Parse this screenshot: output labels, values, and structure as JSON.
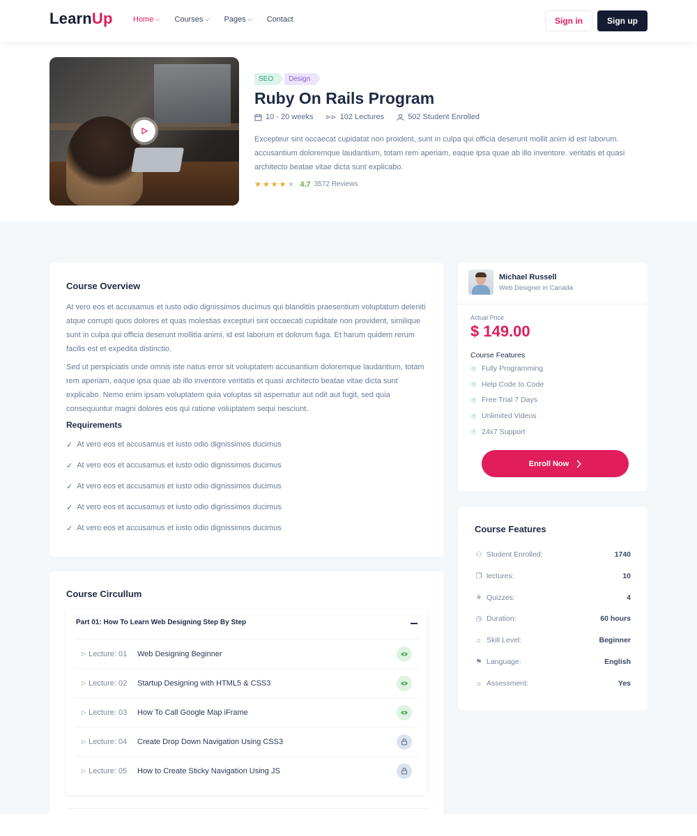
{
  "nav": {
    "logo_main": "Learn",
    "logo_accent": "Up",
    "menu": [
      {
        "label": "Home",
        "active": true,
        "dropdown": true
      },
      {
        "label": "Courses",
        "active": false,
        "dropdown": true
      },
      {
        "label": "Pages",
        "active": false,
        "dropdown": true
      },
      {
        "label": "Contact",
        "active": false,
        "dropdown": false
      }
    ],
    "signin": "Sign in",
    "signup": "Sign up"
  },
  "course": {
    "tags": [
      "SEO",
      "Design"
    ],
    "title": "Ruby On Rails Program",
    "duration": "10 - 20 weeks",
    "lectures": "102 Lectures",
    "enrolled": "502 Student Enrolled",
    "description": "Excepteur sint occaecat cupidatat non proident, sunt in culpa qui officia deserunt mollit anim id est laborum. accusantium doloremque laudantium, totam rem aperiam, eaque ipsa quae ab illo inventore. veritatis et quasi architecto beatae vitae dicta sunt explicabo.",
    "rating_value": "4.7",
    "rating_stars": 4,
    "reviews": "3572 Reviews"
  },
  "overview": {
    "title": "Course Overview",
    "p1": "At vero eos et accusamus et iusto odio dignissimos ducimus qui blanditiis praesentium voluptatum deleniti atque corrupti quos dolores et quas molestias excepturi sint occaecati cupiditate non provident, similique sunt in culpa qui officia deserunt mollitia animi, id est laborum et dolorum fuga. Et harum quidem rerum facilis est et expedita distinctio.",
    "p2": "Sed ut perspiciatis unde omnis iste natus error sit voluptatem accusantium doloremque laudantium, totam rem aperiam, eaque ipsa quae ab illo inventore veritatis et quasi architecto beatae vitae dicta sunt explicabo. Nemo enim ipsam voluptatem quia voluptas sit aspernatur aut odit aut fugit, sed quia consequuntur magni dolores eos qui ratione voluptatem sequi nesciunt.",
    "req_title": "Requirements",
    "requirements": [
      "At vero eos et accusamus et iusto odio dignissimos ducimus",
      "At vero eos et accusamus et iusto odio dignissimos ducimus",
      "At vero eos et accusamus et iusto odio dignissimos ducimus",
      "At vero eos et accusamus et iusto odio dignissimos ducimus",
      "At vero eos et accusamus et iusto odio dignissimos ducimus"
    ]
  },
  "curriculum": {
    "title": "Course Circullum",
    "part_title": "Part 01: How To Learn Web Designing Step By Step",
    "lectures": [
      {
        "num": "Lecture: 01",
        "title": "Web Designing Beginner",
        "icon": "eye-icon"
      },
      {
        "num": "Lecture: 02",
        "title": "Startup Designing with HTML5 & CSS3",
        "icon": "eye-icon"
      },
      {
        "num": "Lecture: 03",
        "title": "How To Call Google Map iFrame",
        "icon": "eye-icon"
      },
      {
        "num": "Lecture: 04",
        "title": "Create Drop Down Navigation Using CSS3",
        "icon": "lock-icon"
      },
      {
        "num": "Lecture: 05",
        "title": "How to Create Sticky Navigation Using JS",
        "icon": "lock-icon"
      }
    ]
  },
  "pricing": {
    "instructor_name": "Michael Russell",
    "instructor_role": "Web Designer in Canada",
    "price_label": "Actual Price",
    "price": "$ 149.00",
    "features_title": "Course Features",
    "features": [
      "Fully Programming",
      "Help Code to Code",
      "Free Trial 7 Days",
      "Unlimited Videos",
      "24x7 Support"
    ],
    "enroll": "Enroll Now"
  },
  "course_features": {
    "title": "Course Features",
    "rows": [
      {
        "icon": "user-icon",
        "label": "Student Enrolled:",
        "value": "1740"
      },
      {
        "icon": "copy-icon",
        "label": "lectures:",
        "value": "10"
      },
      {
        "icon": "puzzle-icon",
        "label": "Quizzes:",
        "value": "4"
      },
      {
        "icon": "clock-icon",
        "label": "Duration:",
        "value": "60 hours"
      },
      {
        "icon": "bookmark-icon",
        "label": "Skill Level:",
        "value": "Beginner"
      },
      {
        "icon": "flag-icon",
        "label": "Language:",
        "value": "English"
      },
      {
        "icon": "sun-icon",
        "label": "Assessment:",
        "value": "Yes"
      }
    ]
  },
  "colors": {
    "accent": "#e11d5b",
    "dark": "#151b31",
    "section_bg": "#f4f7fa"
  }
}
